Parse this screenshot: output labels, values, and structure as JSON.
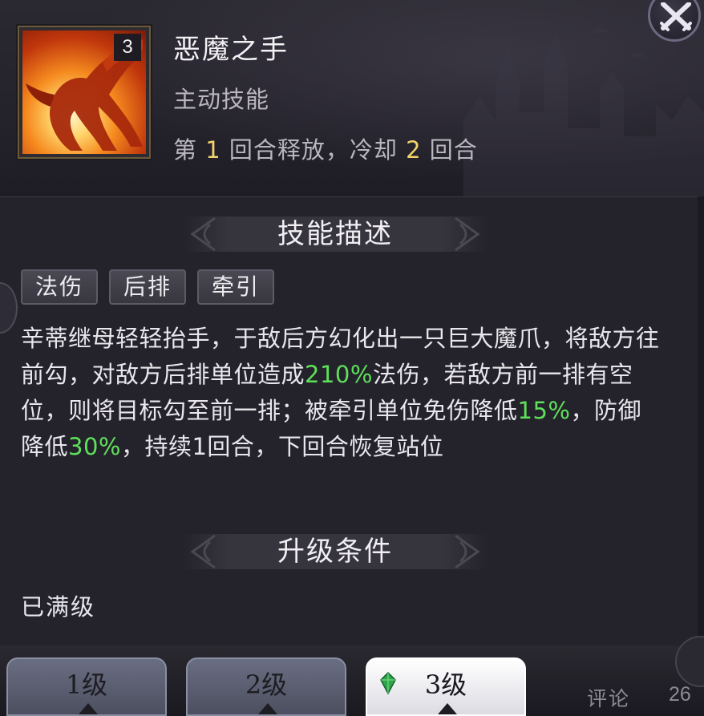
{
  "skill": {
    "level": "3",
    "title": "恶魔之手",
    "type": "主动技能",
    "timing": {
      "part1": "第 ",
      "round": "1",
      "part2": " 回合释放，冷却 ",
      "cooldown": "2",
      "part3": " 回合"
    }
  },
  "sections": {
    "description_title": "技能描述",
    "upgrade_title": "升级条件"
  },
  "tags": [
    "法伤",
    "后排",
    "牵引"
  ],
  "description": {
    "t1": "辛蒂继母轻轻抬手，于敌后方幻化出一只巨大魔爪，将敌方往前勾，对敌方后排单位造成",
    "v1": "210%",
    "t2": "法伤，若敌方前一排有空位，则将目标勾至前一排；被牵引单位免伤降低",
    "v2": "15%",
    "t3": "，防御降低",
    "v3": "30%",
    "t4": "，持续1回合，下回合恢复站位"
  },
  "upgrade_status": "已满级",
  "level_tabs": [
    {
      "label": "1级",
      "selected": false
    },
    {
      "label": "2级",
      "selected": false
    },
    {
      "label": "3级",
      "selected": true
    }
  ],
  "footer": {
    "comment": "评论",
    "count": "26"
  },
  "colors": {
    "highlight_yellow": "#f3d36a",
    "highlight_green": "#5ee05a"
  },
  "icons": {
    "close": "crossed-swords-icon",
    "skill": "demon-claw-icon",
    "selected_tab": "green-gem-icon"
  }
}
